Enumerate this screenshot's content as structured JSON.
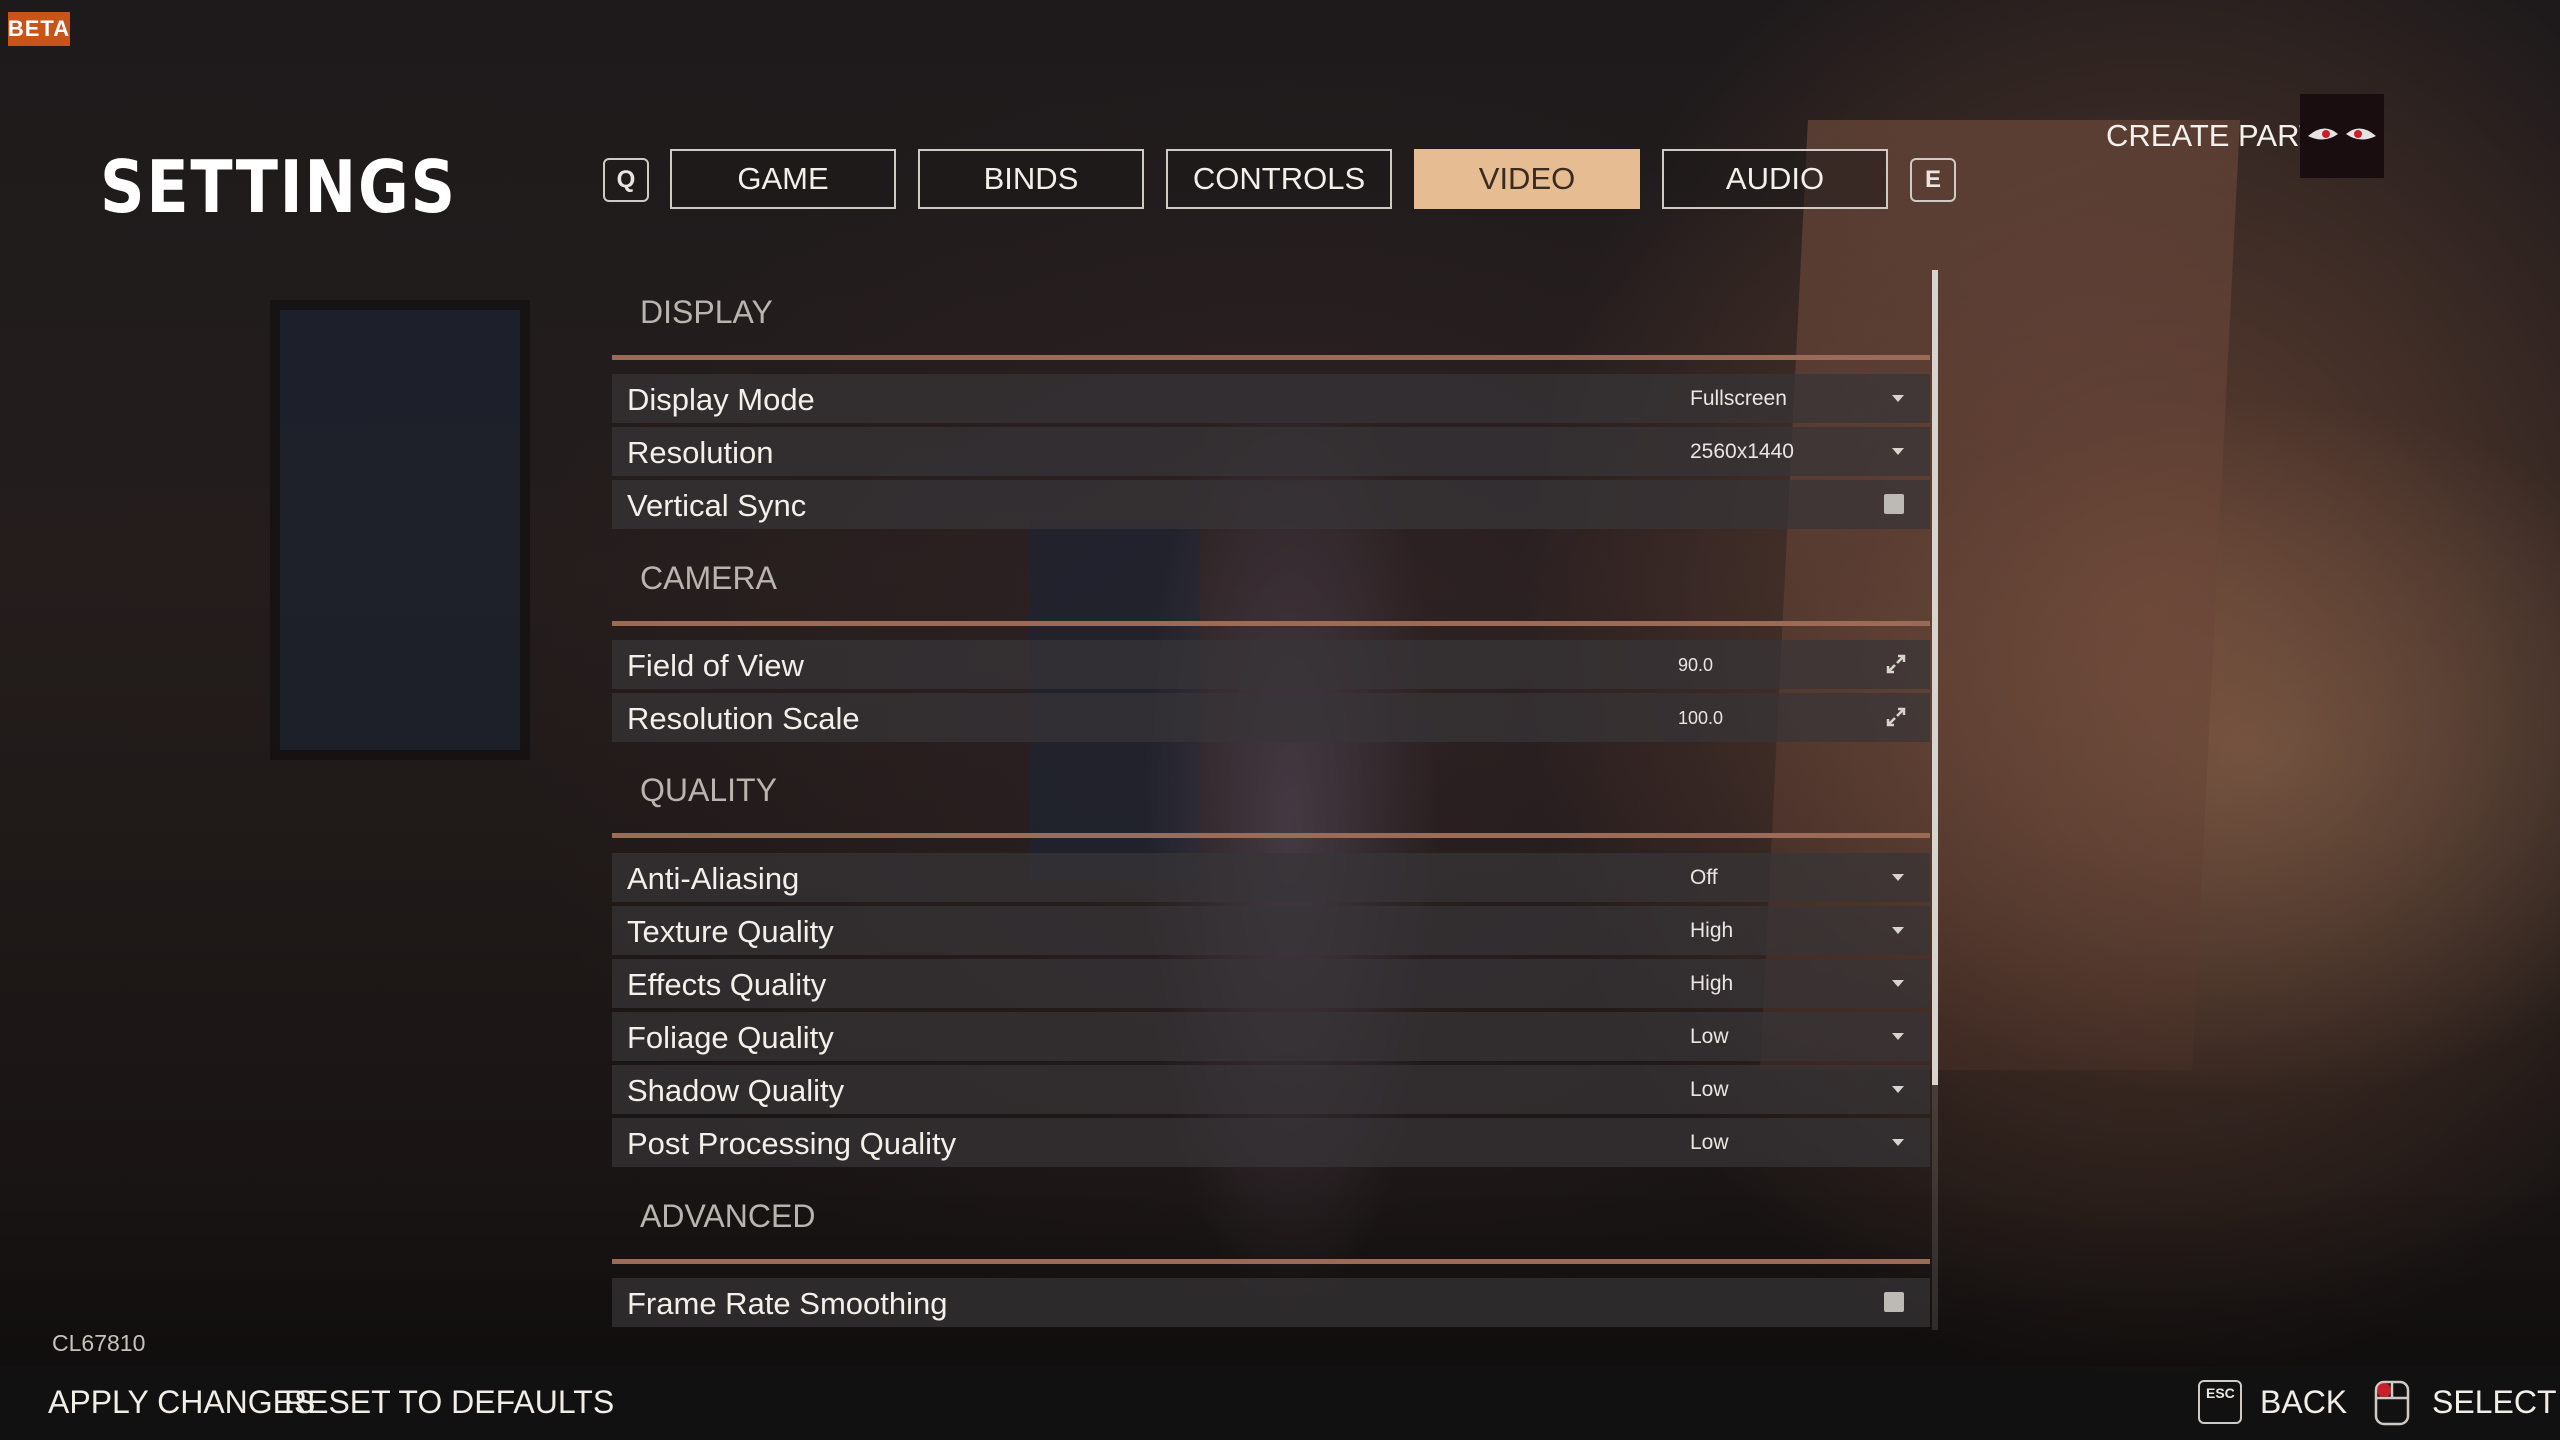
{
  "badge": "BETA",
  "title": "SETTINGS",
  "tab_keys": {
    "prev": "Q",
    "next": "E"
  },
  "tabs": [
    {
      "label": "GAME",
      "active": false
    },
    {
      "label": "BINDS",
      "active": false
    },
    {
      "label": "CONTROLS",
      "active": false
    },
    {
      "label": "VIDEO",
      "active": true
    },
    {
      "label": "AUDIO",
      "active": false
    }
  ],
  "party": {
    "label": "CREATE PARTY",
    "avatar_icon": "red-eyes-icon"
  },
  "sections": {
    "display": {
      "title": "DISPLAY",
      "display_mode": {
        "label": "Display Mode",
        "value": "Fullscreen"
      },
      "resolution": {
        "label": "Resolution",
        "value": "2560x1440"
      },
      "vertical_sync": {
        "label": "Vertical Sync",
        "checked": false
      }
    },
    "camera": {
      "title": "CAMERA",
      "field_of_view": {
        "label": "Field of View",
        "value": "90.0"
      },
      "resolution_scale": {
        "label": "Resolution Scale",
        "value": "100.0"
      }
    },
    "quality": {
      "title": "QUALITY",
      "anti_aliasing": {
        "label": "Anti-Aliasing",
        "value": "Off"
      },
      "texture_quality": {
        "label": "Texture Quality",
        "value": "High"
      },
      "effects_quality": {
        "label": "Effects Quality",
        "value": "High"
      },
      "foliage_quality": {
        "label": "Foliage Quality",
        "value": "Low"
      },
      "shadow_quality": {
        "label": "Shadow Quality",
        "value": "Low"
      },
      "post_processing_quality": {
        "label": "Post Processing Quality",
        "value": "Low"
      }
    },
    "advanced": {
      "title": "ADVANCED",
      "frame_rate_smoothing": {
        "label": "Frame Rate Smoothing",
        "checked": false
      }
    }
  },
  "build_id": "CL67810",
  "bottom": {
    "apply": "APPLY CHANGES",
    "reset": "RESET TO DEFAULTS",
    "back_key": "ESC",
    "back": "BACK",
    "select": "SELECT"
  },
  "colors": {
    "accent_tab": "#e6bd93",
    "section_rule": "#9c6b58",
    "beta_badge": "#c8541a"
  }
}
